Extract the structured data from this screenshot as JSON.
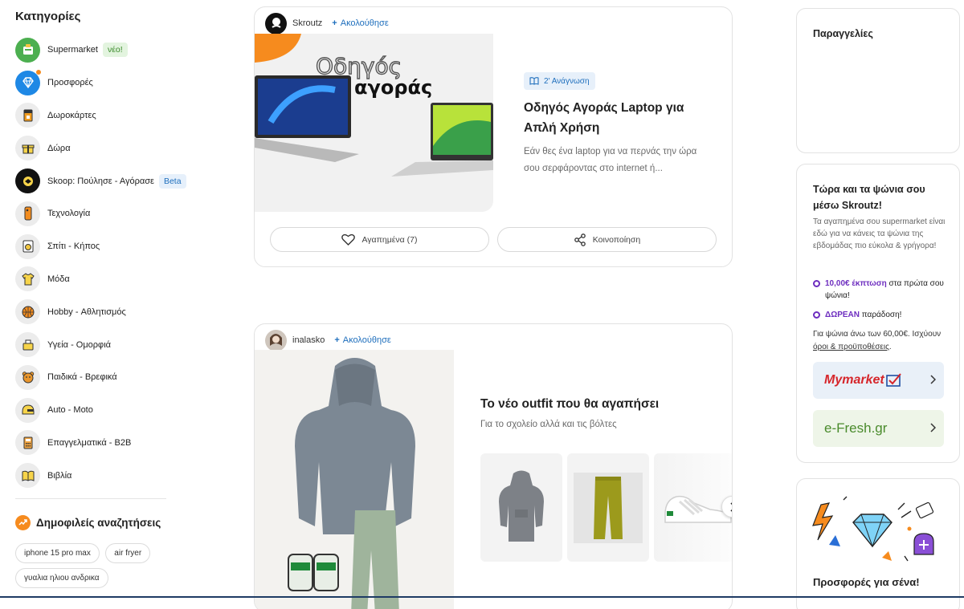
{
  "sidebar": {
    "title": "Κατηγορίες",
    "categories": [
      {
        "label": "Supermarket",
        "tag": "νέο!",
        "icon": "supermarket-icon"
      },
      {
        "label": "Προσφορές",
        "icon": "diamond-icon"
      },
      {
        "label": "Δωροκάρτες",
        "icon": "giftcard-icon"
      },
      {
        "label": "Δώρα",
        "icon": "gift-icon"
      },
      {
        "label": "Skoop: Πούλησε - Αγόρασε",
        "tag": "Beta",
        "icon": "skoop-icon"
      },
      {
        "label": "Τεχνολογία",
        "icon": "phone-icon"
      },
      {
        "label": "Σπίτι - Κήπος",
        "icon": "washer-icon"
      },
      {
        "label": "Μόδα",
        "icon": "shirt-icon"
      },
      {
        "label": "Hobby - Αθλητισμός",
        "icon": "ball-icon"
      },
      {
        "label": "Υγεία - Ομορφιά",
        "icon": "beauty-icon"
      },
      {
        "label": "Παιδικά - Βρεφικά",
        "icon": "teddy-icon"
      },
      {
        "label": "Auto - Moto",
        "icon": "helmet-icon"
      },
      {
        "label": "Επαγγελματικά - B2B",
        "icon": "calculator-icon"
      },
      {
        "label": "Βιβλία",
        "icon": "book-icon"
      }
    ],
    "popular_title": "Δημοφιλείς αναζητήσεις",
    "popular_searches": [
      "iphone 15 pro max",
      "air fryer",
      "γυαλια ηλιου ανδρικα"
    ]
  },
  "feed": {
    "card1": {
      "author": "Skroutz",
      "follow": "Ακολούθησε",
      "hero_text_1": "Οδηγός",
      "hero_text_2": "αγοράς",
      "badge": "2' Ανάγνωση",
      "title": "Οδηγός Αγοράς Laptop για Απλή Χρήση",
      "description": "Εάν θες ένα laptop για να περνάς την ώρα σου σερφάροντας στο internet ή...",
      "favorites": "Αγαπημένα (7)",
      "share": "Κοινοποίηση"
    },
    "card2": {
      "author": "inalasko",
      "follow": "Ακολούθησε",
      "title": "Το νέο outfit που θα αγαπήσει",
      "subtitle": "Για το σχολείο αλλά και τις βόλτες"
    }
  },
  "right": {
    "orders_title": "Παραγγελίες",
    "grocery": {
      "title": "Τώρα και τα ψώνια σου μέσω Skroutz!",
      "text": "Τα αγαπημένα σου supermarket είναι εδώ για να κάνεις τα ψώνια της εβδομάδας πιο εύκολα & γρήγορα!",
      "perk1_bold": "10,00€ έκπτωση",
      "perk1_rest": " στα πρώτα σου ψώνια!",
      "perk2_bold": "ΔΩΡΕΑΝ",
      "perk2_rest": " παράδοση!",
      "note": "Για ψώνια άνω των 60,00€. Ισχύουν ",
      "note_link": "όροι & προϋποθέσεις",
      "note_end": ".",
      "store1": "Mymarket",
      "store2": "e-Fresh.gr"
    },
    "offers_title": "Προσφορές για σένα!"
  },
  "colors": {
    "accent_orange": "#f68b1e",
    "link_blue": "#1f6fbd",
    "promo_purple": "#6d2dbf",
    "mymarket_red": "#d6262b",
    "efresh_green": "#4a8b2c"
  }
}
